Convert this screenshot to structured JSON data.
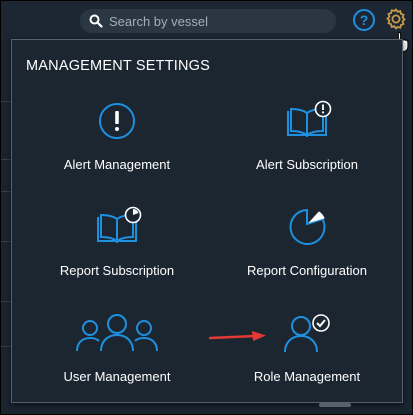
{
  "search": {
    "placeholder": "Search by vessel"
  },
  "header": {
    "help_label": "?"
  },
  "panel": {
    "title": "MANAGEMENT SETTINGS",
    "items": [
      {
        "label": "Alert Management",
        "icon": "alert-icon"
      },
      {
        "label": "Alert Subscription",
        "icon": "book-alert-icon"
      },
      {
        "label": "Report Subscription",
        "icon": "book-chart-icon"
      },
      {
        "label": "Report Configuration",
        "icon": "pie-chart-icon"
      },
      {
        "label": "User Management",
        "icon": "users-icon"
      },
      {
        "label": "Role Management",
        "icon": "user-check-icon"
      }
    ]
  },
  "colors": {
    "accent": "#1e90e0",
    "background": "#1b2631",
    "annotation_arrow": "#e53935"
  }
}
